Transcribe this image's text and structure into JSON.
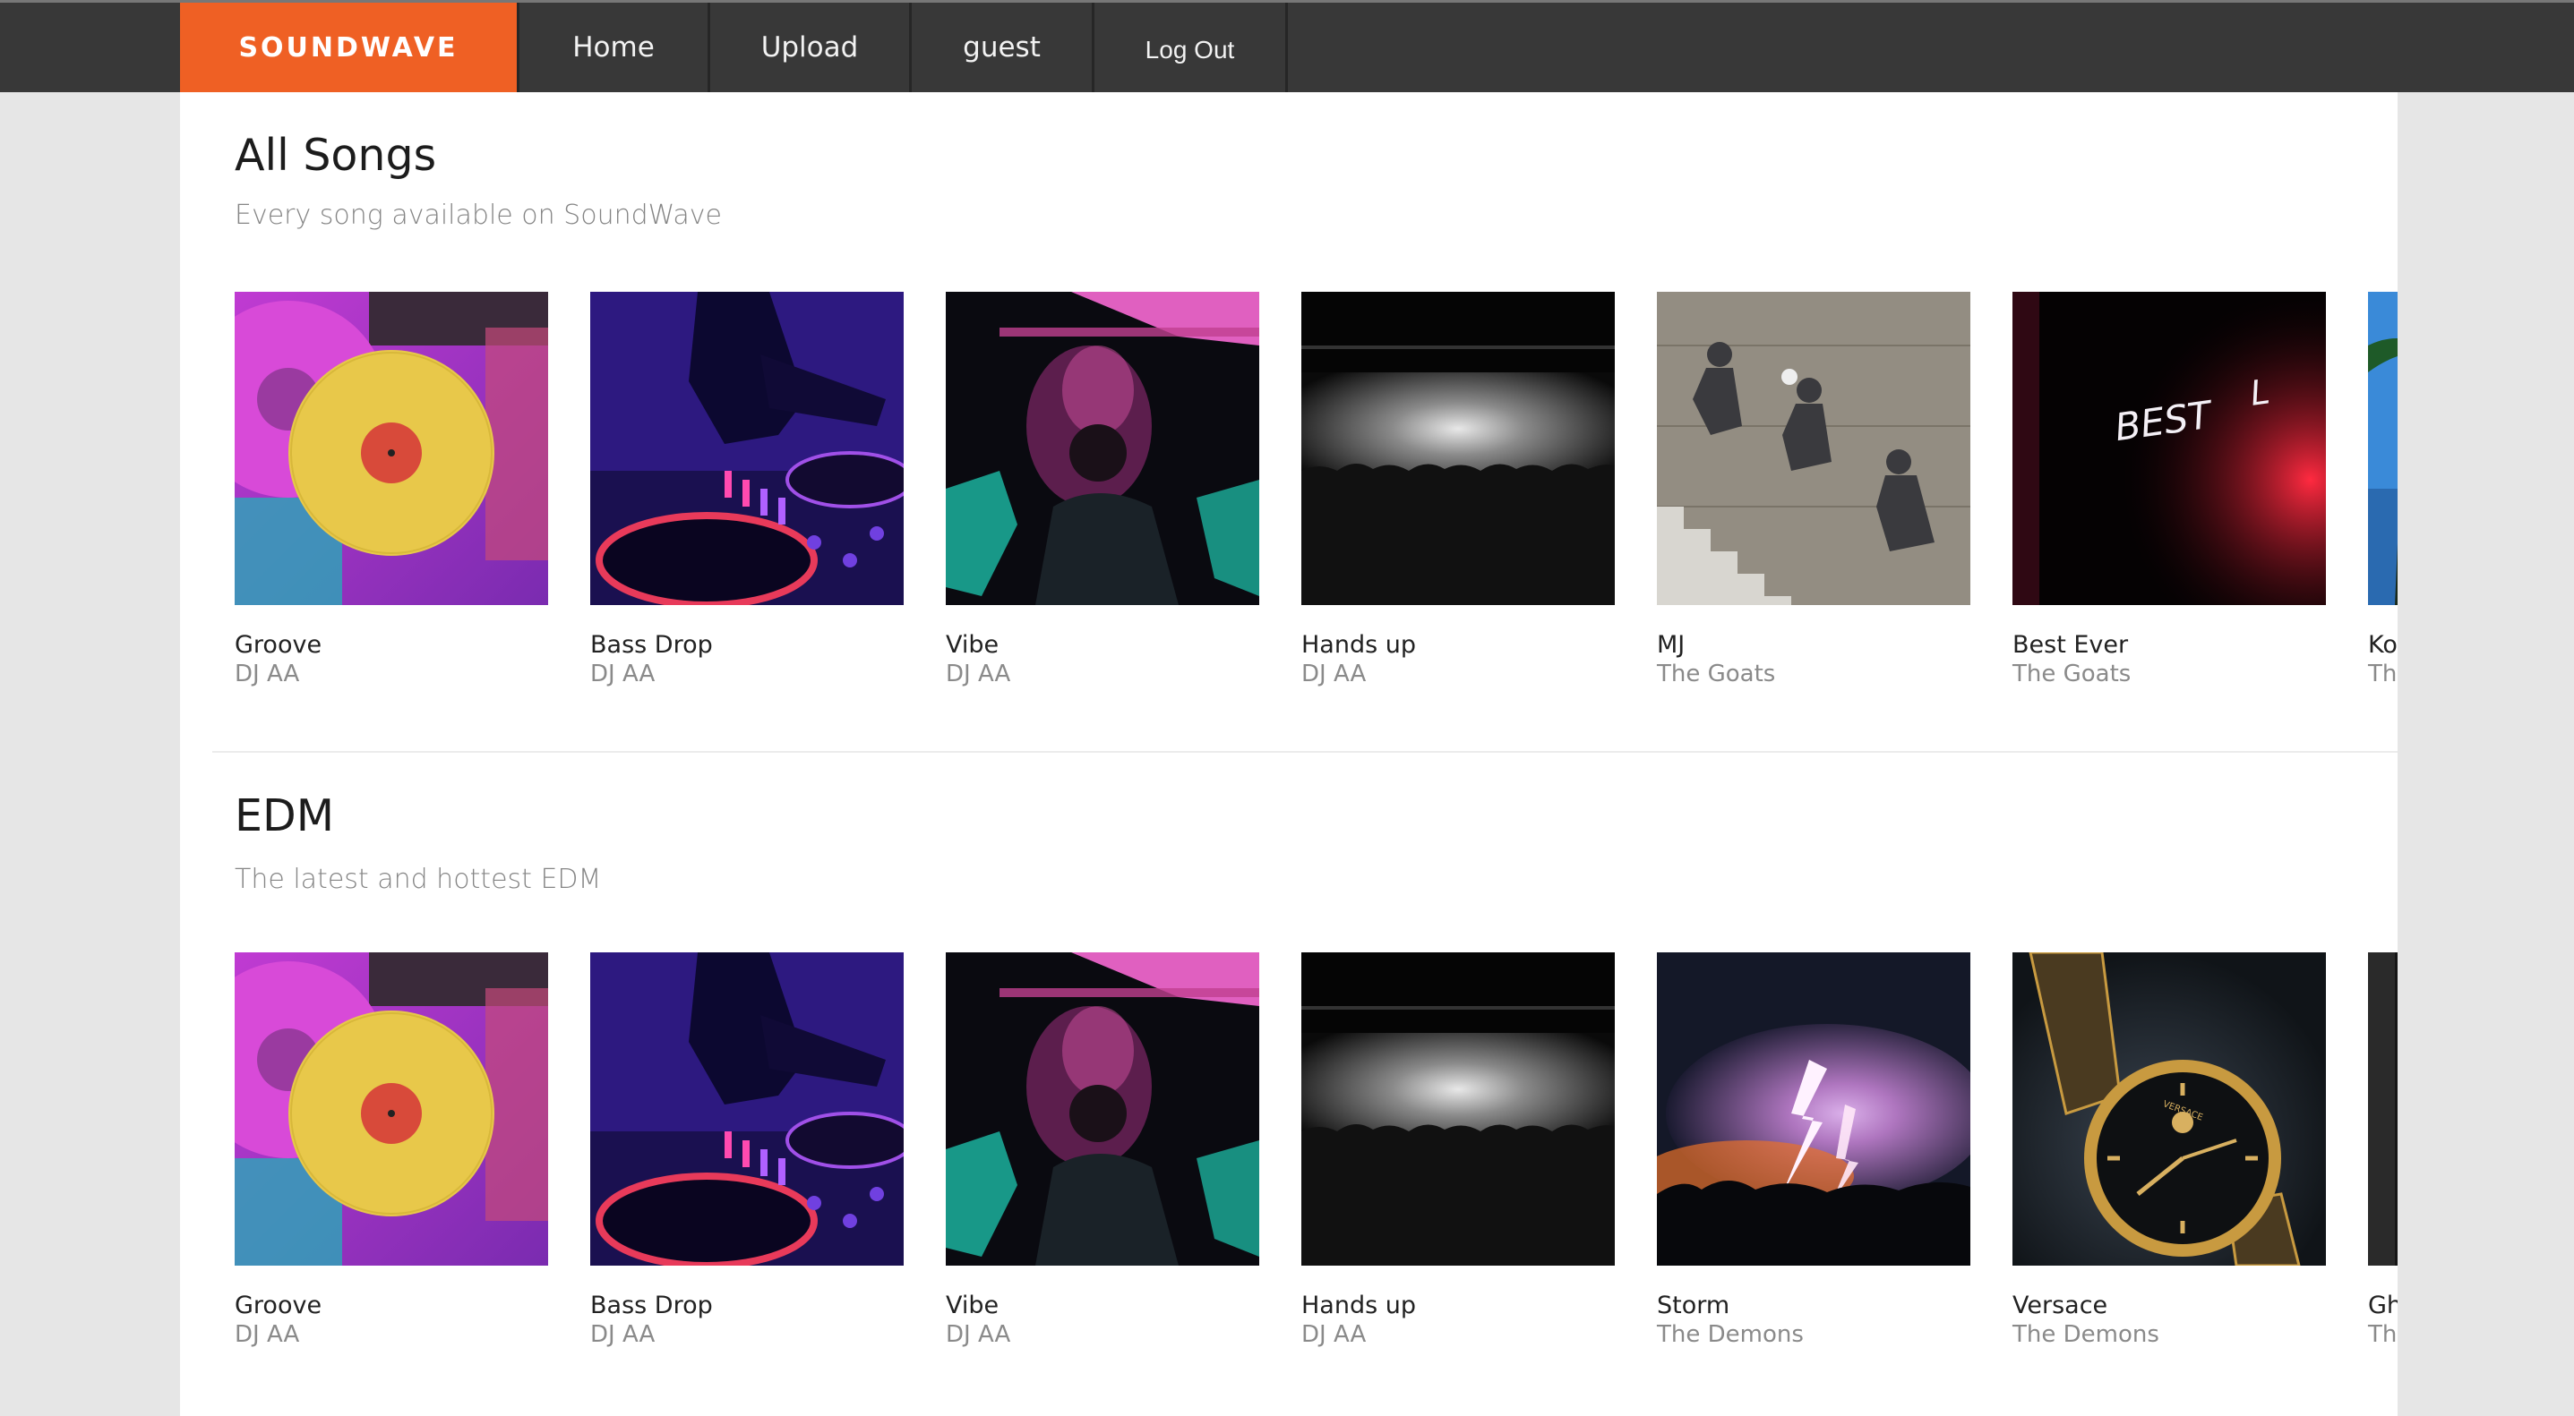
{
  "nav": {
    "brand": "SOUNDWAVE",
    "home": "Home",
    "upload": "Upload",
    "user": "guest",
    "logout": "Log Out"
  },
  "sections": [
    {
      "title": "All Songs",
      "subtitle": "Every song available on SoundWave",
      "songs": [
        {
          "title": "Groove",
          "artist": "DJ AA",
          "art": "vinyl-records"
        },
        {
          "title": "Bass Drop",
          "artist": "DJ AA",
          "art": "dj-turntable"
        },
        {
          "title": "Vibe",
          "artist": "DJ AA",
          "art": "smoky-club"
        },
        {
          "title": "Hands up",
          "artist": "DJ AA",
          "art": "concert-crowd"
        },
        {
          "title": "MJ",
          "artist": "The Goats",
          "art": "basketball-mural"
        },
        {
          "title": "Best Ever",
          "artist": "The Goats",
          "art": "neon-sign"
        },
        {
          "title": "Ko",
          "artist": "Th",
          "art": "palm-tree"
        }
      ]
    },
    {
      "title": "EDM",
      "subtitle": "The latest and hottest EDM",
      "songs": [
        {
          "title": "Groove",
          "artist": "DJ AA",
          "art": "vinyl-records"
        },
        {
          "title": "Bass Drop",
          "artist": "DJ AA",
          "art": "dj-turntable"
        },
        {
          "title": "Vibe",
          "artist": "DJ AA",
          "art": "smoky-club"
        },
        {
          "title": "Hands up",
          "artist": "DJ AA",
          "art": "concert-crowd"
        },
        {
          "title": "Storm",
          "artist": "The Demons",
          "art": "lightning-storm"
        },
        {
          "title": "Versace",
          "artist": "The Demons",
          "art": "gold-watch"
        },
        {
          "title": "Gh",
          "artist": "Th",
          "art": "dark-cover"
        }
      ]
    }
  ],
  "art_text": {
    "neon": "BEST",
    "watch_brand": "VERSACE"
  }
}
